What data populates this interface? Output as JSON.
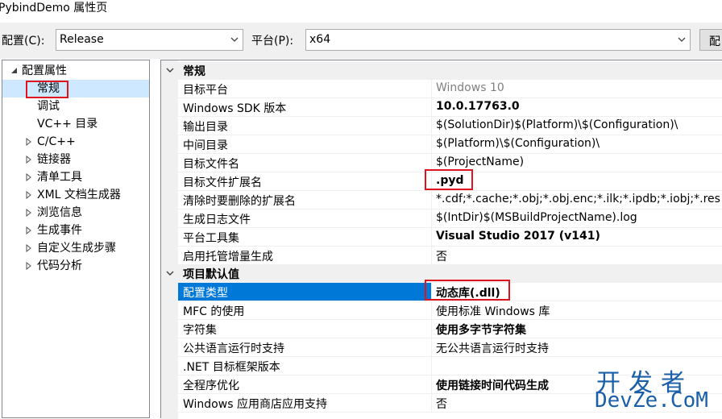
{
  "window": {
    "title": "PybindDemo 属性页"
  },
  "toolbar": {
    "config_label": "配置(C):",
    "config_value": "Release",
    "platform_label": "平台(P):",
    "platform_value": "x64",
    "manager_button": "配"
  },
  "tree": {
    "root": "配置属性",
    "items": [
      {
        "label": "常规",
        "expandable": false,
        "selected": true
      },
      {
        "label": "调试",
        "expandable": false
      },
      {
        "label": "VC++ 目录",
        "expandable": false
      },
      {
        "label": "C/C++",
        "expandable": true
      },
      {
        "label": "链接器",
        "expandable": true
      },
      {
        "label": "清单工具",
        "expandable": true
      },
      {
        "label": "XML 文档生成器",
        "expandable": true
      },
      {
        "label": "浏览信息",
        "expandable": true
      },
      {
        "label": "生成事件",
        "expandable": true
      },
      {
        "label": "自定义生成步骤",
        "expandable": true
      },
      {
        "label": "代码分析",
        "expandable": true
      }
    ]
  },
  "grid": {
    "categories": [
      {
        "name": "常规",
        "rows": [
          {
            "name": "目标平台",
            "value": "Windows 10",
            "dim": true
          },
          {
            "name": "Windows SDK 版本",
            "value": "10.0.17763.0",
            "bold": true
          },
          {
            "name": "输出目录",
            "value": "$(SolutionDir)$(Platform)\\$(Configuration)\\"
          },
          {
            "name": "中间目录",
            "value": "$(Platform)\\$(Configuration)\\"
          },
          {
            "name": "目标文件名",
            "value": "$(ProjectName)"
          },
          {
            "name": "目标文件扩展名",
            "value": ".pyd",
            "bold": true,
            "highlight": true
          },
          {
            "name": "清除时要删除的扩展名",
            "value": "*.cdf;*.cache;*.obj;*.obj.enc;*.ilk;*.ipdb;*.iobj;*.res"
          },
          {
            "name": "生成日志文件",
            "value": "$(IntDir)$(MSBuildProjectName).log"
          },
          {
            "name": "平台工具集",
            "value": "Visual Studio 2017 (v141)",
            "bold": true
          },
          {
            "name": "启用托管增量生成",
            "value": "否"
          }
        ]
      },
      {
        "name": "项目默认值",
        "rows": [
          {
            "name": "配置类型",
            "value": "动态库(.dll)",
            "bold": true,
            "selected": true,
            "highlight": true
          },
          {
            "name": "MFC 的使用",
            "value": "使用标准 Windows 库"
          },
          {
            "name": "字符集",
            "value": "使用多字节字符集",
            "bold": true
          },
          {
            "name": "公共语言运行时支持",
            "value": "无公共语言运行时支持"
          },
          {
            "name": ".NET 目标框架版本",
            "value": ""
          },
          {
            "name": "全程序优化",
            "value": "使用链接时间代码生成",
            "bold": true
          },
          {
            "name": "Windows 应用商店应用支持",
            "value": "否"
          }
        ]
      }
    ]
  },
  "watermark": {
    "line1": "开发者",
    "line2": "DevZe.CoM"
  },
  "colors": {
    "selection": "#0078d7",
    "tree_selection": "#cde8ff",
    "annotation_red": "#e0141e",
    "watermark": "#1a5fa8"
  }
}
